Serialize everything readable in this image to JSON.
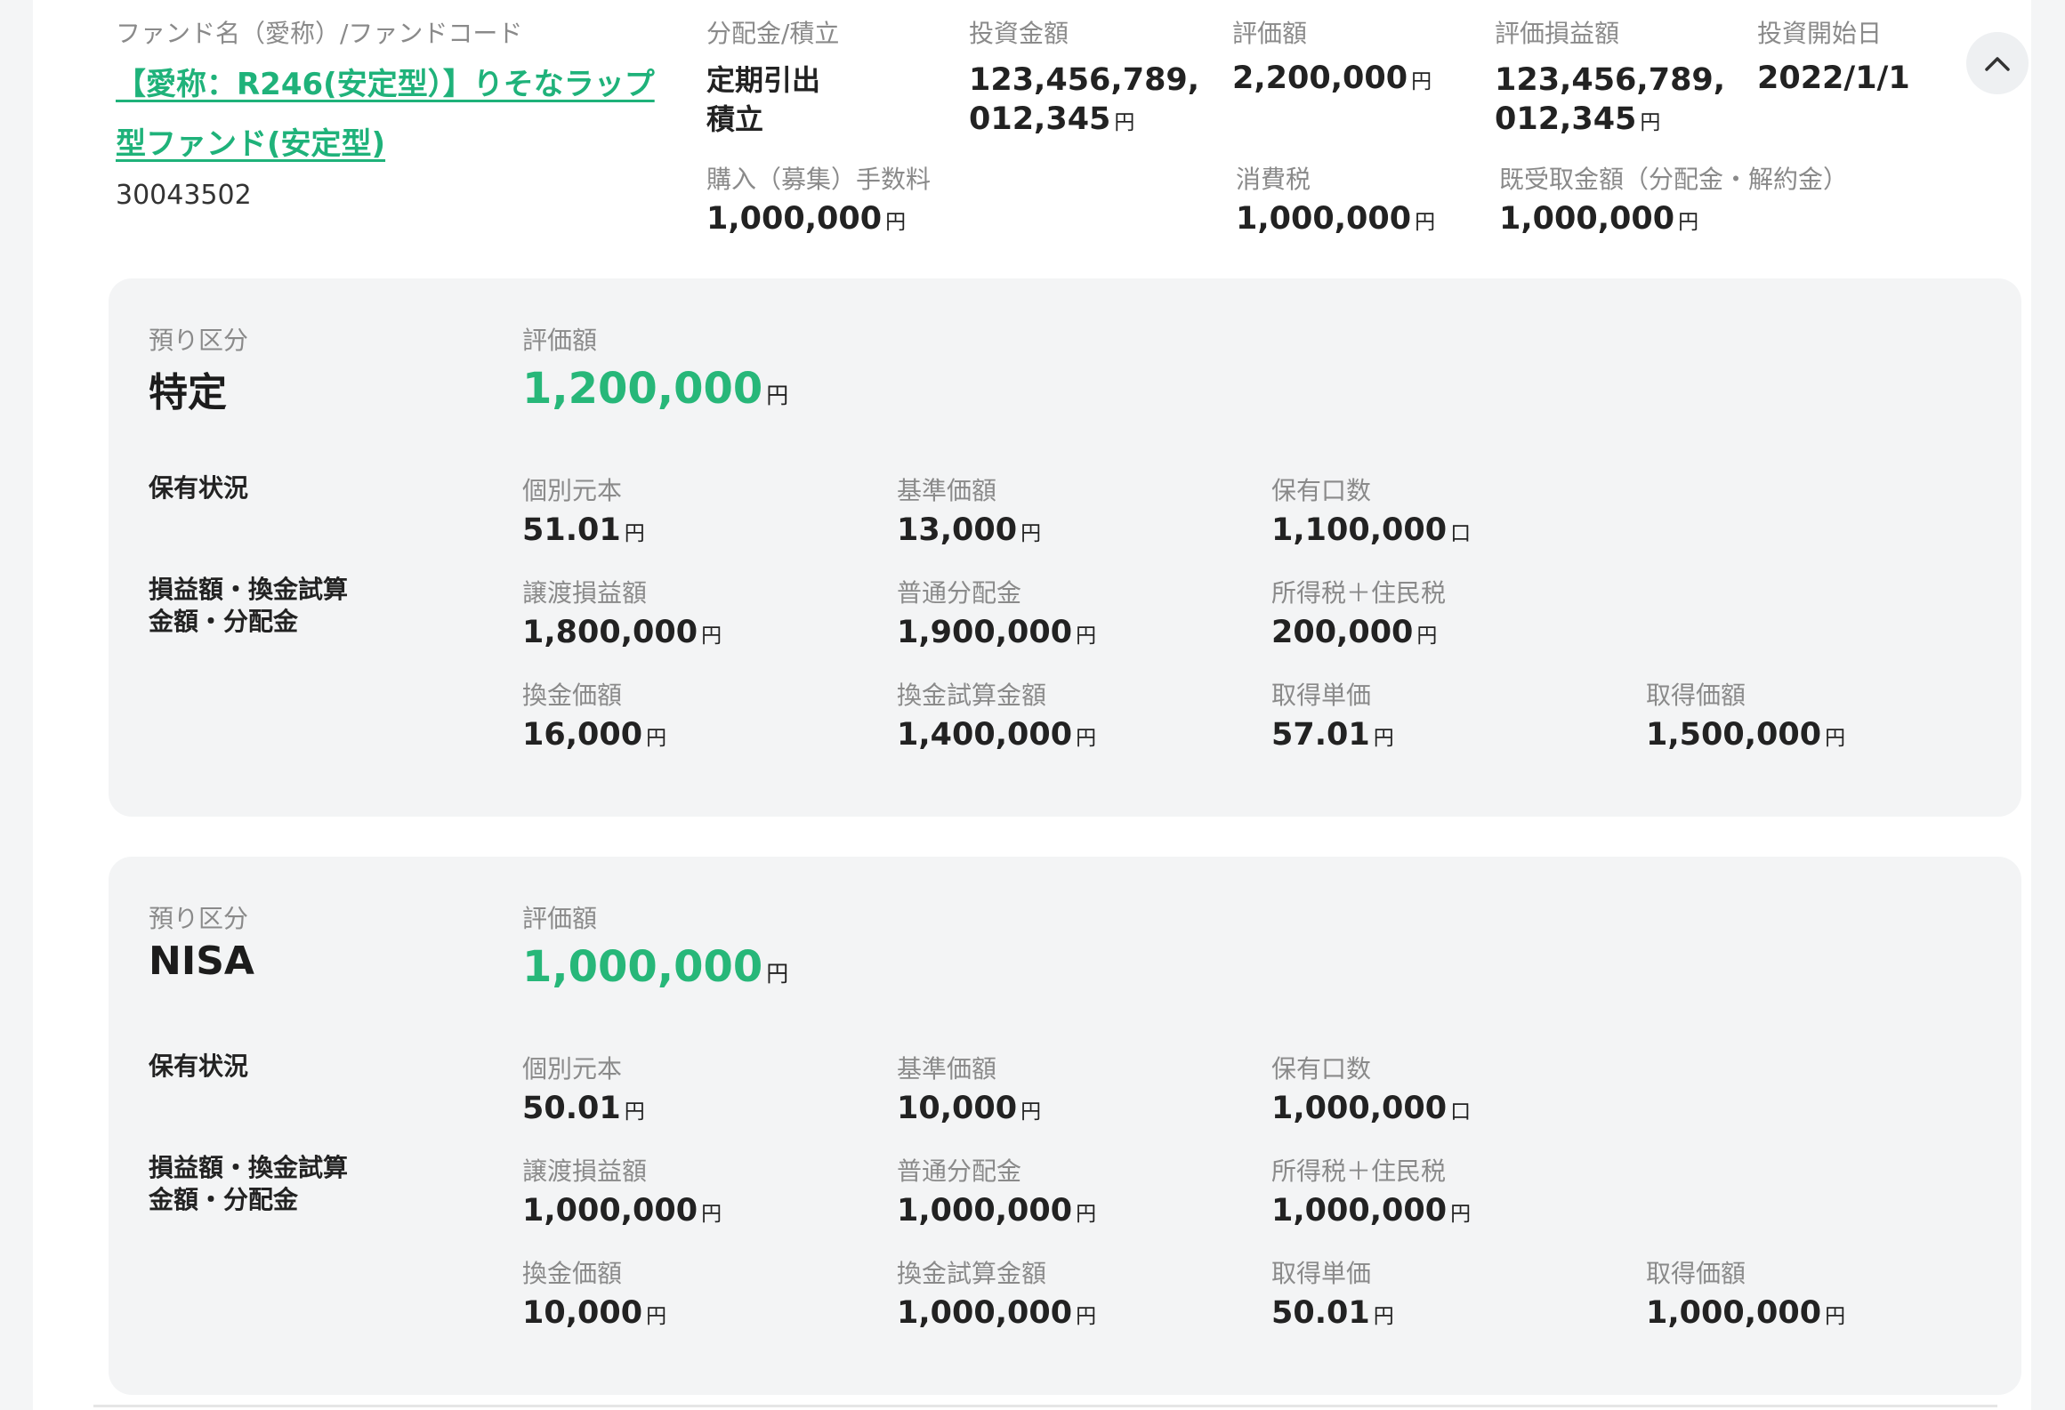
{
  "fund": {
    "header_label": "ファンド名（愛称）/ファンドコード",
    "name_line1": "【愛称：R246(安定型）】りそなラップ",
    "name_line2": "型ファンド(安定型)",
    "code": "30043502",
    "dist_label": "分配金/積立",
    "dist_value1": "定期引出",
    "dist_value2": "積立",
    "invest_label": "投資金額",
    "invest_line1": "123,456,789,",
    "invest_line2": "012,345",
    "valuation_label": "評価額",
    "valuation_value": "2,200,000",
    "pl_label": "評価損益額",
    "pl_line1": "123,456,789,",
    "pl_line2": "012,345",
    "start_label": "投資開始日",
    "start_value": "2022/1/1",
    "fee_label": "購入（募集）手数料",
    "fee_value": "1,000,000",
    "tax_label": "消費税",
    "tax_value": "1,000,000",
    "received_label": "既受取金額（分配金・解約金）",
    "received_value": "1,000,000",
    "toggle_icon": "chevron-up-icon"
  },
  "yen": "円",
  "unit_kuchi": "口",
  "panels": [
    {
      "kind_label": "預り区分",
      "kind": "特定",
      "val_label": "評価額",
      "val": "1,200,000",
      "holding_label": "保有状況",
      "pl_section_label": "損益額・換金試算金額・分配金",
      "principal_label": "個別元本",
      "principal": "51.01",
      "base_label": "基準価額",
      "base": "13,000",
      "units_label": "保有口数",
      "units": "1,100,000",
      "transfer_label": "譲渡損益額",
      "transfer": "1,800,000",
      "dividend_label": "普通分配金",
      "dividend": "1,900,000",
      "tax_label": "所得税＋住民税",
      "tax": "200,000",
      "cash_label": "換金価額",
      "cash": "16,000",
      "cash_est_label": "換金試算金額",
      "cash_est": "1,400,000",
      "unit_price_label": "取得単価",
      "unit_price": "57.01",
      "acq_label": "取得価額",
      "acq": "1,500,000"
    },
    {
      "kind_label": "預り区分",
      "kind": "NISA",
      "val_label": "評価額",
      "val": "1,000,000",
      "holding_label": "保有状況",
      "pl_section_label": "損益額・換金試算金額・分配金",
      "principal_label": "個別元本",
      "principal": "50.01",
      "base_label": "基準価額",
      "base": "10,000",
      "units_label": "保有口数",
      "units": "1,000,000",
      "transfer_label": "譲渡損益額",
      "transfer": "1,000,000",
      "dividend_label": "普通分配金",
      "dividend": "1,000,000",
      "tax_label": "所得税＋住民税",
      "tax": "1,000,000",
      "cash_label": "換金価額",
      "cash": "10,000",
      "cash_est_label": "換金試算金額",
      "cash_est": "1,000,000",
      "unit_price_label": "取得単価",
      "unit_price": "50.01",
      "acq_label": "取得価額",
      "acq": "1,000,000"
    }
  ],
  "colors": {
    "accent": "#27b779",
    "link": "#1fb27a",
    "panel_bg": "#f3f4f5"
  }
}
